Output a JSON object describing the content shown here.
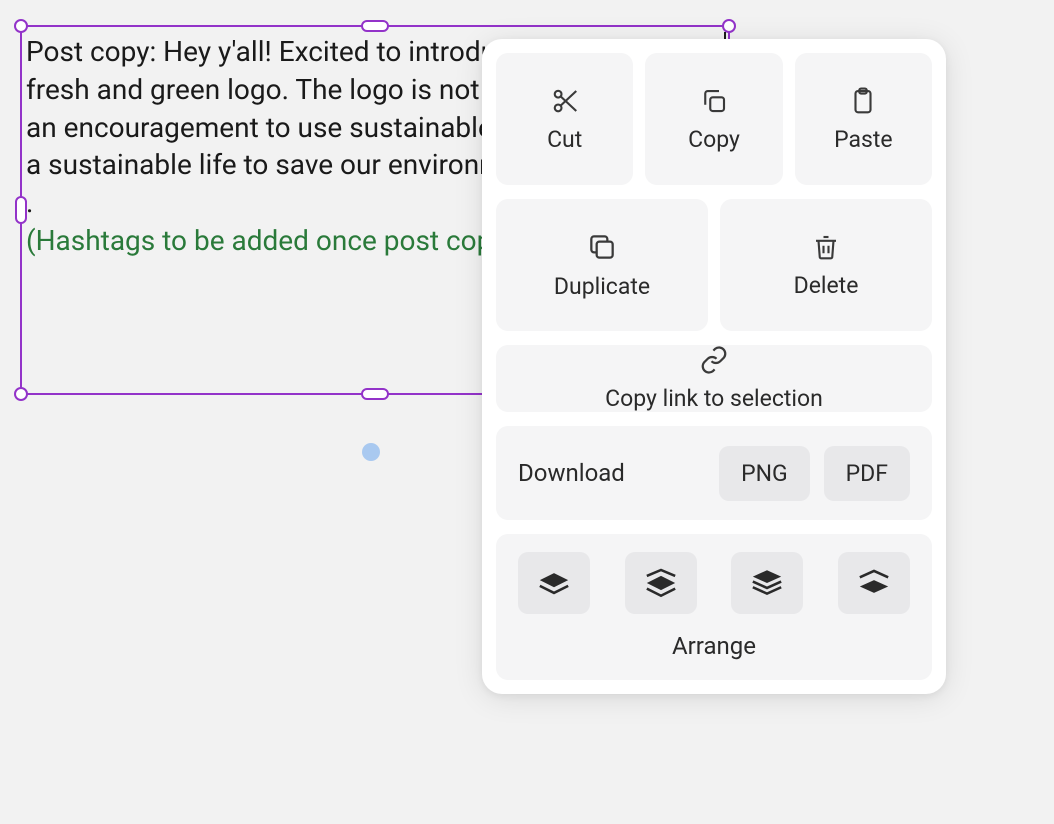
{
  "canvas": {
    "text_main": "Post copy: Hey y'all! Excited to introduce our very new, fresh and green logo. The logo is not only about us but an encouragement to use sustainable products and lead a sustainable life to save our environment.",
    "text_dot": ".",
    "text_hashtag": "(Hashtags to be added once post copy is finalised)"
  },
  "menu": {
    "cut": "Cut",
    "copy": "Copy",
    "paste": "Paste",
    "duplicate": "Duplicate",
    "delete": "Delete",
    "copy_link": "Copy link to selection",
    "download": "Download",
    "png": "PNG",
    "pdf": "PDF",
    "arrange": "Arrange"
  }
}
